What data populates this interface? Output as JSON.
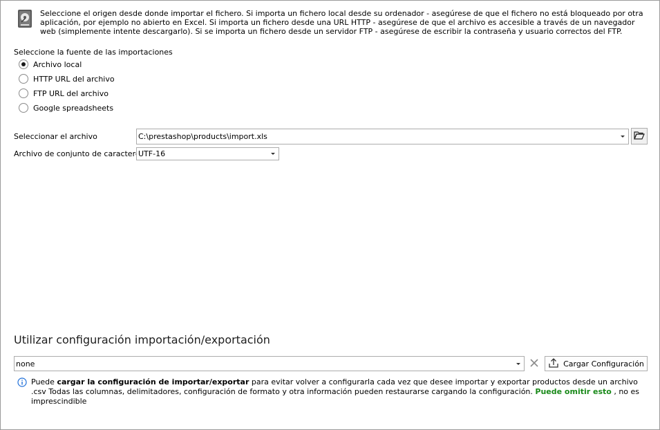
{
  "intro_text": "Seleccione el origen desde donde importar el fichero. Si importa un fichero local desde su ordenador - asegúrese de que el fichero no está bloqueado por otra aplicación, por ejemplo no abierto en Excel. Si importa un fichero desde una URL HTTP - asegúrese de que el archivo es accesible a través de un navegador web (simplemente intente descargarlo). Si se importa un fichero desde un servidor FTP - asegúrese de escribir la contraseña y usuario correctos del FTP.",
  "source": {
    "label": "Seleccione la fuente de las importaciones",
    "options": [
      {
        "label": "Archivo local",
        "selected": true
      },
      {
        "label": "HTTP URL del archivo",
        "selected": false
      },
      {
        "label": "FTP URL del archivo",
        "selected": false
      },
      {
        "label": "Google spreadsheets",
        "selected": false
      }
    ]
  },
  "file": {
    "label": "Seleccionar el archivo",
    "value": "C:\\prestashop\\products\\import.xls"
  },
  "charset": {
    "label": "Archivo de conjunto de caracteres",
    "value": "UTF-16"
  },
  "config": {
    "title": "Utilizar configuración importación/exportación",
    "value": "none",
    "load_button": "Cargar Configuración"
  },
  "info": {
    "part1": "Puede ",
    "bold": "cargar la configuración de importar/exportar",
    "part2": " para evitar volver a configurarla cada vez que desee importar y exportar productos desde un archivo .csv Todas las columnas, delimitadores, configuración de formato y otra información pueden restaurarse cargando la configuración. ",
    "skip": "Puede omitir esto",
    "part3": " , no es imprescindible"
  },
  "colors": {
    "accent_info": "#1e6fd9",
    "skip_green": "#1a8a1a"
  }
}
